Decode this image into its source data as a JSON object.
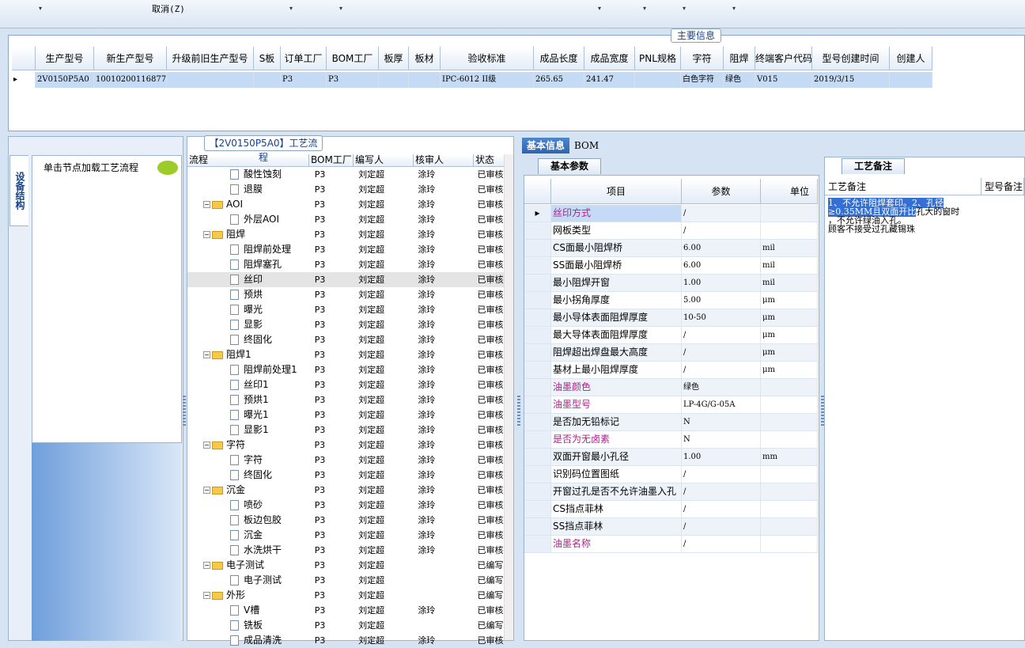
{
  "toolbar": {
    "cancel_label": "取消(Z)",
    "dropdown_arrows": [
      "▾",
      "▾",
      "▾",
      "▾",
      "▾",
      "▾",
      "▾"
    ]
  },
  "main_info": {
    "legend": "主要信息",
    "columns": [
      "生产型号",
      "新生产型号",
      "升级前旧生产型号",
      "S板",
      "订单工厂",
      "BOM工厂",
      "板厚",
      "板材",
      "验收标准",
      "成品长度",
      "成品宽度",
      "PNL规格",
      "字符",
      "阻焊",
      "终端客户代码",
      "型号创建时间",
      "创建人"
    ],
    "row": [
      "2V0150P5A0",
      "10010200116877",
      "",
      "",
      "P3",
      "P3",
      "",
      "",
      "IPC-6012 II级",
      "265.65",
      "241.47",
      "",
      "白色字符",
      "绿色",
      "V015",
      "2019/3/15",
      ""
    ]
  },
  "left_panel": {
    "vertical_tab": "设备结构",
    "node_hint": "单击节点加载工艺流程"
  },
  "flow": {
    "title": "【2V0150P5A0】工艺流程",
    "columns": [
      "流程",
      "BOM工厂",
      "编写人",
      "核审人",
      "状态"
    ],
    "rows": [
      {
        "name": "酸性蚀刻",
        "level": 2,
        "type": "doc",
        "bom": "P3",
        "author": "刘定超",
        "reviewer": "涂玲",
        "status": "已审核"
      },
      {
        "name": "退膜",
        "level": 2,
        "type": "doc",
        "bom": "P3",
        "author": "刘定超",
        "reviewer": "涂玲",
        "status": "已审核"
      },
      {
        "name": "AOI",
        "level": 1,
        "type": "folder",
        "bom": "P3",
        "author": "刘定超",
        "reviewer": "涂玲",
        "status": "已审核"
      },
      {
        "name": "外层AOI",
        "level": 2,
        "type": "doc",
        "bom": "P3",
        "author": "刘定超",
        "reviewer": "涂玲",
        "status": "已审核"
      },
      {
        "name": "阻焊",
        "level": 1,
        "type": "folder",
        "bom": "P3",
        "author": "刘定超",
        "reviewer": "涂玲",
        "status": "已审核"
      },
      {
        "name": "阻焊前处理",
        "level": 2,
        "type": "doc",
        "bom": "P3",
        "author": "刘定超",
        "reviewer": "涂玲",
        "status": "已审核"
      },
      {
        "name": "阻焊塞孔",
        "level": 2,
        "type": "doc",
        "bom": "P3",
        "author": "刘定超",
        "reviewer": "涂玲",
        "status": "已审核"
      },
      {
        "name": "丝印",
        "level": 2,
        "type": "doc",
        "bom": "P3",
        "author": "刘定超",
        "reviewer": "涂玲",
        "status": "已审核",
        "selected": true
      },
      {
        "name": "预烘",
        "level": 2,
        "type": "doc",
        "bom": "P3",
        "author": "刘定超",
        "reviewer": "涂玲",
        "status": "已审核"
      },
      {
        "name": "曝光",
        "level": 2,
        "type": "doc",
        "bom": "P3",
        "author": "刘定超",
        "reviewer": "涂玲",
        "status": "已审核"
      },
      {
        "name": "显影",
        "level": 2,
        "type": "doc",
        "bom": "P3",
        "author": "刘定超",
        "reviewer": "涂玲",
        "status": "已审核"
      },
      {
        "name": "终固化",
        "level": 2,
        "type": "doc",
        "bom": "P3",
        "author": "刘定超",
        "reviewer": "涂玲",
        "status": "已审核"
      },
      {
        "name": "阻焊1",
        "level": 1,
        "type": "folder",
        "bom": "P3",
        "author": "刘定超",
        "reviewer": "涂玲",
        "status": "已审核"
      },
      {
        "name": "阻焊前处理1",
        "level": 2,
        "type": "doc",
        "bom": "P3",
        "author": "刘定超",
        "reviewer": "涂玲",
        "status": "已审核"
      },
      {
        "name": "丝印1",
        "level": 2,
        "type": "doc",
        "bom": "P3",
        "author": "刘定超",
        "reviewer": "涂玲",
        "status": "已审核"
      },
      {
        "name": "预烘1",
        "level": 2,
        "type": "doc",
        "bom": "P3",
        "author": "刘定超",
        "reviewer": "涂玲",
        "status": "已审核"
      },
      {
        "name": "曝光1",
        "level": 2,
        "type": "doc",
        "bom": "P3",
        "author": "刘定超",
        "reviewer": "涂玲",
        "status": "已审核"
      },
      {
        "name": "显影1",
        "level": 2,
        "type": "doc",
        "bom": "P3",
        "author": "刘定超",
        "reviewer": "涂玲",
        "status": "已审核"
      },
      {
        "name": "字符",
        "level": 1,
        "type": "folder",
        "bom": "P3",
        "author": "刘定超",
        "reviewer": "涂玲",
        "status": "已审核"
      },
      {
        "name": "字符",
        "level": 2,
        "type": "doc",
        "bom": "P3",
        "author": "刘定超",
        "reviewer": "涂玲",
        "status": "已审核"
      },
      {
        "name": "终固化",
        "level": 2,
        "type": "doc",
        "bom": "P3",
        "author": "刘定超",
        "reviewer": "涂玲",
        "status": "已审核"
      },
      {
        "name": "沉金",
        "level": 1,
        "type": "folder",
        "bom": "P3",
        "author": "刘定超",
        "reviewer": "涂玲",
        "status": "已审核"
      },
      {
        "name": "喷砂",
        "level": 2,
        "type": "doc",
        "bom": "P3",
        "author": "刘定超",
        "reviewer": "涂玲",
        "status": "已审核"
      },
      {
        "name": "板边包胶",
        "level": 2,
        "type": "doc",
        "bom": "P3",
        "author": "刘定超",
        "reviewer": "涂玲",
        "status": "已审核"
      },
      {
        "name": "沉金",
        "level": 2,
        "type": "doc",
        "bom": "P3",
        "author": "刘定超",
        "reviewer": "涂玲",
        "status": "已审核"
      },
      {
        "name": "水洗烘干",
        "level": 2,
        "type": "doc",
        "bom": "P3",
        "author": "刘定超",
        "reviewer": "涂玲",
        "status": "已审核"
      },
      {
        "name": "电子测试",
        "level": 1,
        "type": "folder",
        "bom": "P3",
        "author": "刘定超",
        "reviewer": "",
        "status": "已编写"
      },
      {
        "name": "电子测试",
        "level": 2,
        "type": "doc",
        "bom": "P3",
        "author": "刘定超",
        "reviewer": "",
        "status": "已编写"
      },
      {
        "name": "外形",
        "level": 1,
        "type": "folder",
        "bom": "P3",
        "author": "刘定超",
        "reviewer": "",
        "status": "已编写"
      },
      {
        "name": "V槽",
        "level": 2,
        "type": "doc",
        "bom": "P3",
        "author": "刘定超",
        "reviewer": "涂玲",
        "status": "已审核"
      },
      {
        "name": "铣板",
        "level": 2,
        "type": "doc",
        "bom": "P3",
        "author": "刘定超",
        "reviewer": "",
        "status": "已编写"
      },
      {
        "name": "成品清洗",
        "level": 2,
        "type": "doc",
        "bom": "P3",
        "author": "刘定超",
        "reviewer": "涂玲",
        "status": "已审核"
      }
    ]
  },
  "detail": {
    "tabs": [
      "基本信息",
      "BOM"
    ],
    "subtab": "基本参数",
    "columns": [
      "项目",
      "参数",
      "单位"
    ],
    "params": [
      {
        "name": "丝印方式",
        "value": "/",
        "unit": "",
        "pink": true
      },
      {
        "name": "网板类型",
        "value": "/",
        "unit": ""
      },
      {
        "name": "CS面最小阻焊桥",
        "value": "6.00",
        "unit": "mil"
      },
      {
        "name": "SS面最小阻焊桥",
        "value": "6.00",
        "unit": "mil"
      },
      {
        "name": "最小阻焊开窗",
        "value": "1.00",
        "unit": "mil"
      },
      {
        "name": "最小拐角厚度",
        "value": "5.00",
        "unit": "μm"
      },
      {
        "name": "最小导体表面阻焊厚度",
        "value": "10-50",
        "unit": "μm"
      },
      {
        "name": "最大导体表面阻焊厚度",
        "value": "/",
        "unit": "μm"
      },
      {
        "name": "阻焊超出焊盘最大高度",
        "value": "/",
        "unit": "μm"
      },
      {
        "name": "基材上最小阻焊厚度",
        "value": "/",
        "unit": "μm"
      },
      {
        "name": "油墨颜色",
        "value": "绿色",
        "unit": "",
        "pink": true
      },
      {
        "name": "油墨型号",
        "value": "LP-4G/G-05A",
        "unit": "",
        "pink": true
      },
      {
        "name": "是否加无铅标记",
        "value": "N",
        "unit": ""
      },
      {
        "name": "是否为无卤素",
        "value": "N",
        "unit": "",
        "pink": true
      },
      {
        "name": "双面开窗最小孔径",
        "value": "1.00",
        "unit": "mm"
      },
      {
        "name": "识别码位置图纸",
        "value": "/",
        "unit": ""
      },
      {
        "name": "开窗过孔是否不允许油墨入孔",
        "value": "/",
        "unit": ""
      },
      {
        "name": "CS挡点菲林",
        "value": "/",
        "unit": ""
      },
      {
        "name": "SS挡点菲林",
        "value": "/",
        "unit": ""
      },
      {
        "name": "油墨名称",
        "value": "/",
        "unit": "",
        "pink": true
      }
    ]
  },
  "remarks": {
    "tab": "工艺备注",
    "columns": [
      "工艺备注",
      "型号备注"
    ],
    "note_highlight": "1、不允许阻焊套印。2、孔径≥0.35MM且双面开比",
    "note_rest_1": "孔大的窗时",
    "note_rest_2": "，不允许绿油入孔。",
    "note_rest_3": "顾客不接受过孔藏锡珠"
  },
  "colors": {
    "accent": "#2b64b0",
    "pink": "#b0208e",
    "highlight": "#3470d4",
    "selected_row": "#c5dbf5"
  }
}
